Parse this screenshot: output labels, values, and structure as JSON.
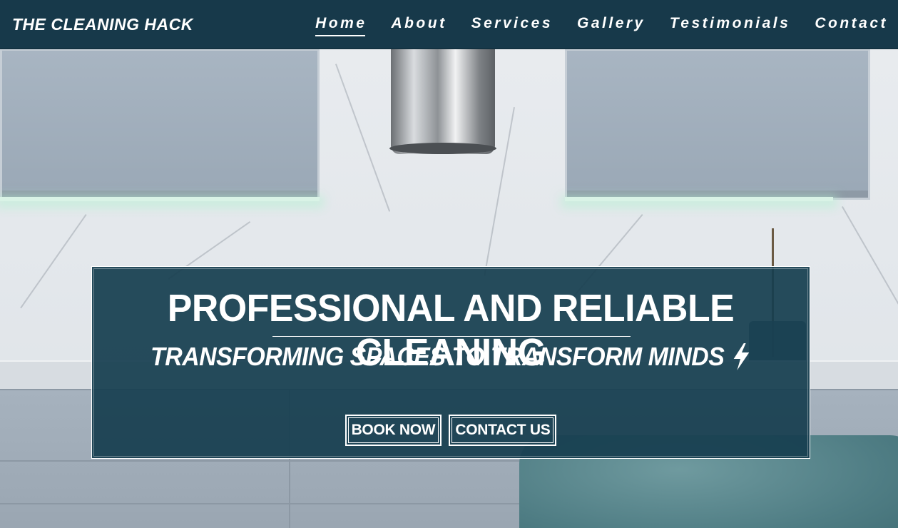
{
  "header": {
    "brand": "THE CLEANING HACK",
    "nav": [
      {
        "label": "Home",
        "active": true
      },
      {
        "label": "About",
        "active": false
      },
      {
        "label": "Services",
        "active": false
      },
      {
        "label": "Gallery",
        "active": false
      },
      {
        "label": "Testimonials",
        "active": false
      },
      {
        "label": "Contact",
        "active": false
      }
    ]
  },
  "hero": {
    "title": "PROFESSIONAL AND RELIABLE CLEANING",
    "subtitle": "TRANSFORMING SPACES TO TRANSFORM MINDS",
    "subtitle_icon": "lightning-bolt-icon",
    "buttons": {
      "book_now": "BOOK NOW",
      "contact_us": "CONTACT US"
    }
  },
  "colors": {
    "header_bg": "#17394a",
    "hero_bg": "#173e50",
    "text": "#ffffff"
  }
}
